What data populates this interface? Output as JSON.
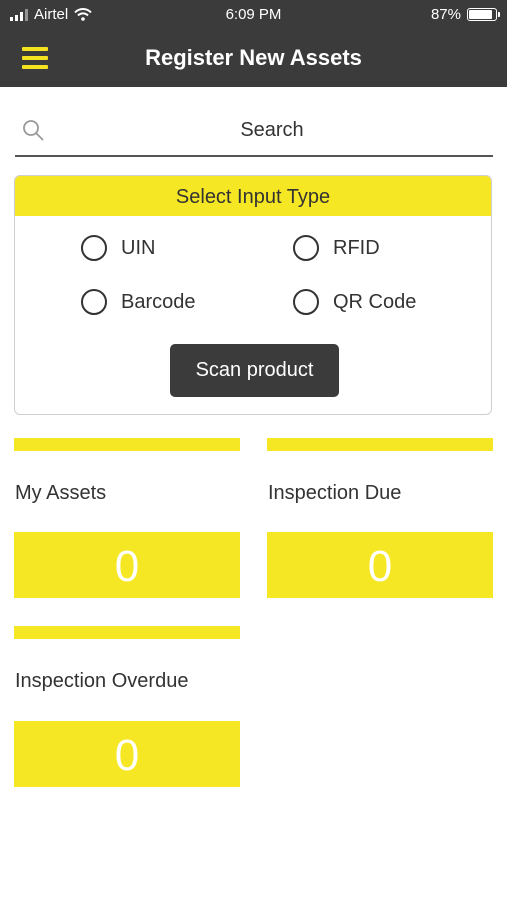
{
  "status_bar": {
    "carrier": "Airtel",
    "time": "6:09 PM",
    "battery_percent": "87%",
    "battery_level": 0.87
  },
  "app_bar": {
    "title": "Register New Assets",
    "menu_icon": "hamburger-menu-icon"
  },
  "search": {
    "placeholder": "Search",
    "icon": "search-icon"
  },
  "input_type": {
    "header": "Select Input Type",
    "options": [
      "UIN",
      "RFID",
      "Barcode",
      "QR Code"
    ],
    "scan_button": "Scan product"
  },
  "tiles": [
    {
      "label": "My Assets",
      "value": "0"
    },
    {
      "label": "Inspection Due",
      "value": "0"
    },
    {
      "label": "Inspection Overdue",
      "value": "0"
    }
  ],
  "colors": {
    "accent_yellow": "#f5e723",
    "dark_bar": "#3b3b3b"
  }
}
